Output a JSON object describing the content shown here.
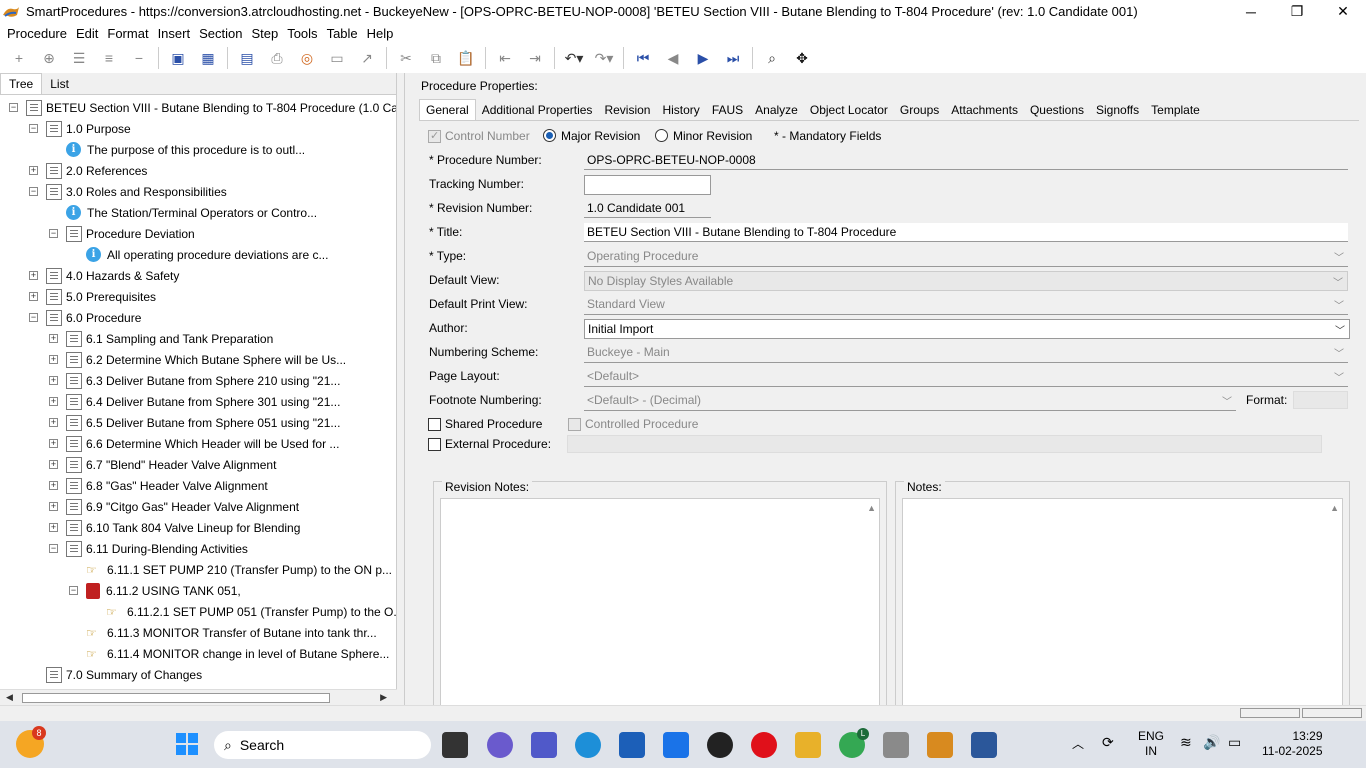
{
  "window": {
    "title": "SmartProcedures - https://conversion3.atrcloudhosting.net - BuckeyeNew - [OPS-OPRC-BETEU-NOP-0008] 'BETEU Section VIII - Butane Blending to T-804 Procedure' (rev: 1.0 Candidate 001)"
  },
  "menu": [
    "Procedure",
    "Edit",
    "Format",
    "Insert",
    "Section",
    "Step",
    "Tools",
    "Table",
    "Help"
  ],
  "left_tabs": [
    "Tree",
    "List"
  ],
  "tree": [
    {
      "label": "BETEU Section VIII - Butane Blending to T-804 Procedure (1.0 Ca...",
      "icon": "doc",
      "exp": "-",
      "level": 0
    },
    {
      "label": "1.0 Purpose",
      "icon": "doc",
      "exp": "-",
      "level": 1
    },
    {
      "label": "The purpose of this procedure is to outl...",
      "icon": "info",
      "exp": "",
      "level": 2
    },
    {
      "label": "2.0 References",
      "icon": "doc",
      "exp": "+",
      "level": 1
    },
    {
      "label": "3.0 Roles and Responsibilities",
      "icon": "doc",
      "exp": "-",
      "level": 1
    },
    {
      "label": "The Station/Terminal Operators or Contro...",
      "icon": "info",
      "exp": "",
      "level": 2
    },
    {
      "label": "Procedure Deviation",
      "icon": "doc",
      "exp": "-",
      "level": 2
    },
    {
      "label": "All operating procedure deviations are c...",
      "icon": "info",
      "exp": "",
      "level": 3
    },
    {
      "label": "4.0 Hazards & Safety",
      "icon": "doc",
      "exp": "+",
      "level": 1
    },
    {
      "label": "5.0 Prerequisites",
      "icon": "doc",
      "exp": "+",
      "level": 1
    },
    {
      "label": "6.0 Procedure",
      "icon": "doc",
      "exp": "-",
      "level": 1
    },
    {
      "label": "6.1 Sampling and Tank Preparation",
      "icon": "doc",
      "exp": "+",
      "level": 2
    },
    {
      "label": "6.2 Determine Which Butane Sphere will be Us...",
      "icon": "doc",
      "exp": "+",
      "level": 2
    },
    {
      "label": "6.3 Deliver Butane from Sphere 210 using \"21...",
      "icon": "doc",
      "exp": "+",
      "level": 2
    },
    {
      "label": "6.4 Deliver Butane from Sphere 301 using \"21...",
      "icon": "doc",
      "exp": "+",
      "level": 2
    },
    {
      "label": "6.5 Deliver Butane from Sphere 051 using \"21...",
      "icon": "doc",
      "exp": "+",
      "level": 2
    },
    {
      "label": "6.6 Determine Which Header will be Used for ...",
      "icon": "doc",
      "exp": "+",
      "level": 2
    },
    {
      "label": "6.7 \"Blend\" Header Valve Alignment",
      "icon": "doc",
      "exp": "+",
      "level": 2
    },
    {
      "label": "6.8 \"Gas\" Header Valve Alignment",
      "icon": "doc",
      "exp": "+",
      "level": 2
    },
    {
      "label": "6.9 \"Citgo Gas\" Header Valve Alignment",
      "icon": "doc",
      "exp": "+",
      "level": 2
    },
    {
      "label": "6.10 Tank 804 Valve Lineup for Blending",
      "icon": "doc",
      "exp": "+",
      "level": 2
    },
    {
      "label": "6.11 During-Blending Activities",
      "icon": "doc",
      "exp": "-",
      "level": 2
    },
    {
      "label": "6.11.1 SET PUMP 210 (Transfer Pump) to the ON p...",
      "icon": "hand",
      "exp": "",
      "level": 3
    },
    {
      "label": "6.11.2 USING TANK 051,",
      "icon": "bell",
      "exp": "-",
      "level": 3
    },
    {
      "label": "6.11.2.1 SET PUMP 051 (Transfer Pump) to the O...",
      "icon": "hand",
      "exp": "",
      "level": 4
    },
    {
      "label": "6.11.3 MONITOR Transfer of Butane into tank thr...",
      "icon": "hand",
      "exp": "",
      "level": 3
    },
    {
      "label": "6.11.4 MONITOR change in level of Butane Sphere...",
      "icon": "hand",
      "exp": "",
      "level": 3
    },
    {
      "label": "7.0 Summary of Changes",
      "icon": "doc",
      "exp": "",
      "level": 1
    }
  ],
  "props": {
    "heading": "Procedure Properties:",
    "tabs": [
      "General",
      "Additional Properties",
      "Revision",
      "History",
      "FAUS",
      "Analyze",
      "Object Locator",
      "Groups",
      "Attachments",
      "Questions",
      "Signoffs",
      "Template"
    ],
    "control_number": "Control Number",
    "major_revision": "Major Revision",
    "minor_revision": "Minor Revision",
    "mandatory": "* - Mandatory Fields",
    "fields": {
      "procedure_number_label": "* Procedure Number:",
      "procedure_number": "OPS-OPRC-BETEU-NOP-0008",
      "tracking_number_label": "Tracking Number:",
      "tracking_number": "",
      "revision_number_label": "* Revision Number:",
      "revision_number": "1.0 Candidate 001",
      "title_label": "* Title:",
      "title": "BETEU Section VIII - Butane Blending to T-804 Procedure",
      "type_label": "* Type:",
      "type": "Operating Procedure",
      "default_view_label": "Default View:",
      "default_view": "No Display Styles Available",
      "default_print_view_label": "Default Print View:",
      "default_print_view": "Standard View",
      "author_label": "Author:",
      "author": "Initial Import",
      "numbering_scheme_label": "Numbering Scheme:",
      "numbering_scheme": "Buckeye - Main",
      "page_layout_label": "Page Layout:",
      "page_layout": "<Default>",
      "footnote_numbering_label": "Footnote Numbering:",
      "footnote_numbering": "<Default> - (Decimal)",
      "format_label": "Format:",
      "shared_procedure": "Shared Procedure",
      "controlled_procedure": "Controlled Procedure",
      "external_procedure": "External Procedure:"
    },
    "revision_notes_label": "Revision Notes:",
    "notes_label": "Notes:"
  },
  "taskbar": {
    "search": "Search",
    "badge": "8",
    "lang": "ENG",
    "region": "IN",
    "time": "13:29",
    "date": "11-02-2025",
    "chrome_badge": "L"
  },
  "colors": {
    "accent": "#1a5fb4",
    "info": "#3ba3e6"
  }
}
